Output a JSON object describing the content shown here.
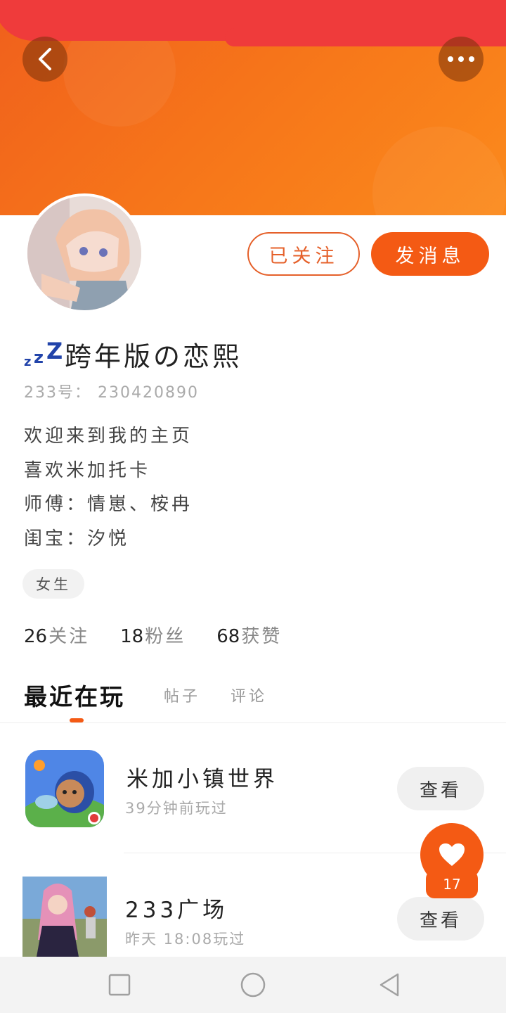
{
  "header": {
    "back_icon": "chevron-left-icon",
    "more_icon": "more-horizontal-icon",
    "accent": "#f45a14"
  },
  "profile": {
    "nickname": "跨年版の恋熙",
    "nickname_prefix_icon": "zzz-icon",
    "uid": "233号： 230420890",
    "bio_lines": [
      "欢迎来到我的主页",
      "喜欢米加托卡",
      "师傅：情崽、桉冉",
      "闺宝：汐悦"
    ],
    "gender_tag": "女生",
    "followed_label": "已关注",
    "message_label": "发消息"
  },
  "stats": [
    {
      "value": "26",
      "label": "关注"
    },
    {
      "value": "18",
      "label": "粉丝"
    },
    {
      "value": "68",
      "label": "获赞"
    }
  ],
  "tabs": [
    "最近在玩",
    "帖子",
    "评论"
  ],
  "games": [
    {
      "title": "米加小镇世界",
      "subtitle": "39分钟前玩过",
      "action": "查看"
    },
    {
      "title": "233广场",
      "subtitle": "昨天 18:08玩过",
      "action": "查看"
    }
  ],
  "like_fab": {
    "icon": "heart-icon",
    "count": "17"
  },
  "navbar": {
    "icons": [
      "square-icon",
      "circle-icon",
      "triangle-back-icon"
    ]
  }
}
